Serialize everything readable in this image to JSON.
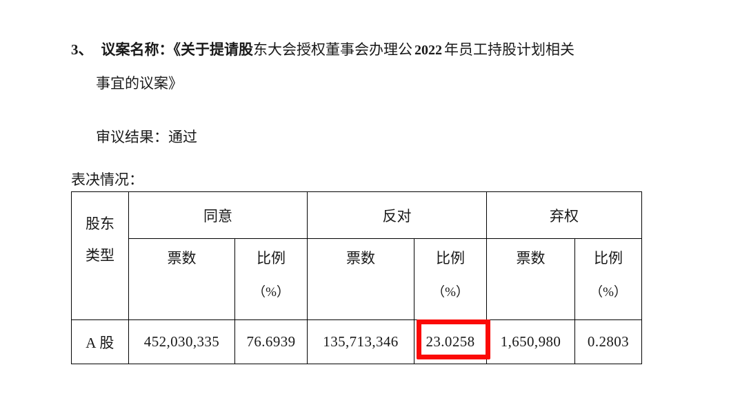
{
  "document": {
    "proposal": {
      "number": "3、",
      "title_lead": "议案名称：《关于提请股",
      "title_body_a": "东大会授权董事会办理公",
      "year": "2022",
      "title_body_b": "年员工持股计划相关",
      "title_line2": "事宜的议案》"
    },
    "result": {
      "label_and_value": "审议结果：通过"
    },
    "vote_section": {
      "label": "表决情况："
    },
    "table": {
      "row_header_type": [
        "股东",
        "类型"
      ],
      "groups": [
        {
          "name": "同意"
        },
        {
          "name": "反对"
        },
        {
          "name": "弃权"
        }
      ],
      "subheaders": [
        {
          "name": "票数",
          "unit": ""
        },
        {
          "name": "比例",
          "unit": "（%）"
        },
        {
          "name": "票数",
          "unit": ""
        },
        {
          "name": "比例",
          "unit": "（%）"
        },
        {
          "name": "票数",
          "unit": ""
        },
        {
          "name": "比例",
          "unit": "（%）"
        }
      ],
      "rows": [
        {
          "type": "A 股",
          "agree_votes": "452,030,335",
          "agree_pct": "76.6939",
          "object_votes": "135,713,346",
          "object_pct": "23.0258",
          "abstain_votes": "1,650,980",
          "abstain_pct": "0.2803"
        }
      ]
    },
    "annotation": {
      "highlight_color": "#fb0a06",
      "highlighted_value": "23.0258"
    }
  }
}
